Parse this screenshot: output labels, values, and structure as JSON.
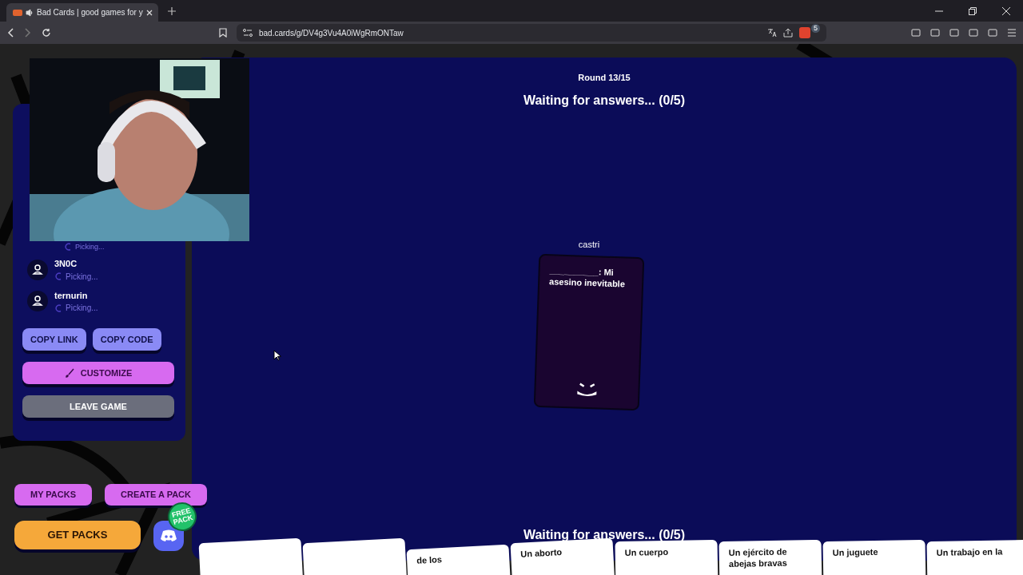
{
  "browser": {
    "tab": {
      "title": "Bad Cards | good games for y",
      "selected": true,
      "muted_audio": true
    },
    "url": "bad.cards/g/DV4g3Vu4A0iWgRmONTaw",
    "shields_count": "5"
  },
  "game": {
    "round": "Round 13/15",
    "status_top": "Waiting for answers... (0/5)",
    "status_bottom": "Waiting for answers... (0/5)",
    "prompt_card": {
      "player": "castri",
      "text": "__________: Mi asesino inevitable"
    }
  },
  "sidebar": {
    "hidden_player_status": "Picking...",
    "players": [
      {
        "name": "3N0C",
        "status": "Picking..."
      },
      {
        "name": "ternurin",
        "status": "Picking..."
      }
    ],
    "buttons": [
      {
        "kind": "copy",
        "label": "COPY LINK"
      },
      {
        "kind": "copy",
        "label": "COPY CODE"
      },
      {
        "kind": "customize",
        "label": "CUSTOMIZE"
      },
      {
        "kind": "leave",
        "label": "LEAVE GAME"
      }
    ]
  },
  "footer_buttons": [
    {
      "label": "MY PACKS"
    },
    {
      "label": "CREATE A PACK"
    }
  ],
  "get_packs": "GET PACKS",
  "discord_badge": "FREE PACK",
  "hand": [
    {
      "kind": "blank"
    },
    {
      "kind": "blank"
    },
    {
      "kind": "answer",
      "text": "de los"
    },
    {
      "kind": "answer",
      "text": "Un aborto"
    },
    {
      "kind": "answer",
      "text": "Un cuerpo"
    },
    {
      "kind": "answer",
      "text": "Un ejército de abejas bravas"
    },
    {
      "kind": "answer",
      "text": "Un juguete"
    },
    {
      "kind": "answer",
      "text": "Un trabajo en la"
    }
  ]
}
